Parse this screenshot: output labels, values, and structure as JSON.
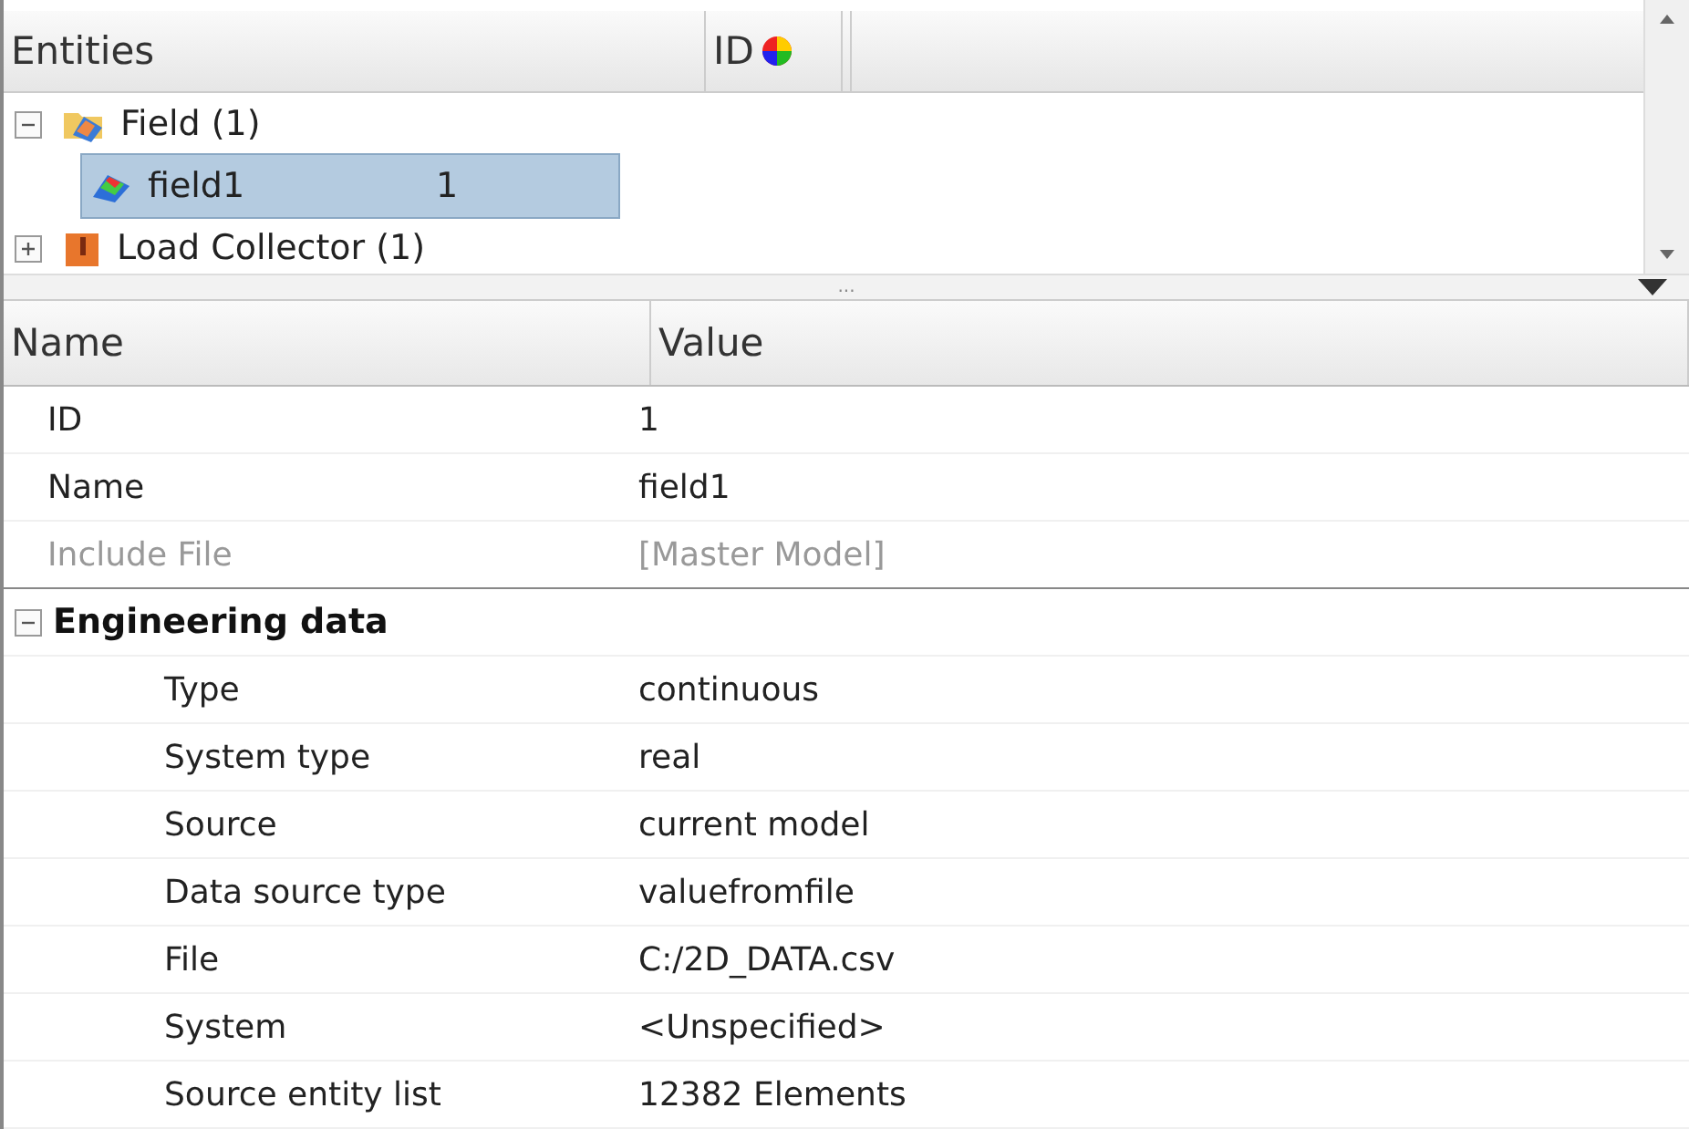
{
  "entity_tree": {
    "columns": [
      "Entities",
      "ID"
    ],
    "items": [
      {
        "label": "Field (1)",
        "kind": "folder",
        "expanded": true,
        "selected": false,
        "children": [
          {
            "label": "field1",
            "kind": "field",
            "id": "1",
            "selected": true
          }
        ]
      },
      {
        "label": "Load Collector (1)",
        "kind": "load",
        "expanded": false,
        "selected": false
      }
    ]
  },
  "splitter": {
    "grip": "..."
  },
  "properties": {
    "columns": [
      "Name",
      "Value"
    ],
    "rows": [
      {
        "kind": "row",
        "name": "ID",
        "value": "1",
        "disabled": false
      },
      {
        "kind": "row",
        "name": "Name",
        "value": "field1",
        "disabled": false
      },
      {
        "kind": "row",
        "name": "Include File",
        "value": "[Master Model]",
        "disabled": true
      },
      {
        "kind": "group",
        "name": "Engineering data",
        "expanded": true,
        "children": [
          {
            "name": "Type",
            "value": "continuous"
          },
          {
            "name": "System type",
            "value": "real"
          },
          {
            "name": "Source",
            "value": "current model"
          },
          {
            "name": "Data source type",
            "value": "valuefromfile"
          },
          {
            "name": "File",
            "value": "C:/2D_DATA.csv"
          },
          {
            "name": "System",
            "value": "<Unspecified>"
          },
          {
            "name": "Source entity list",
            "value": "12382 Elements"
          }
        ]
      }
    ]
  }
}
